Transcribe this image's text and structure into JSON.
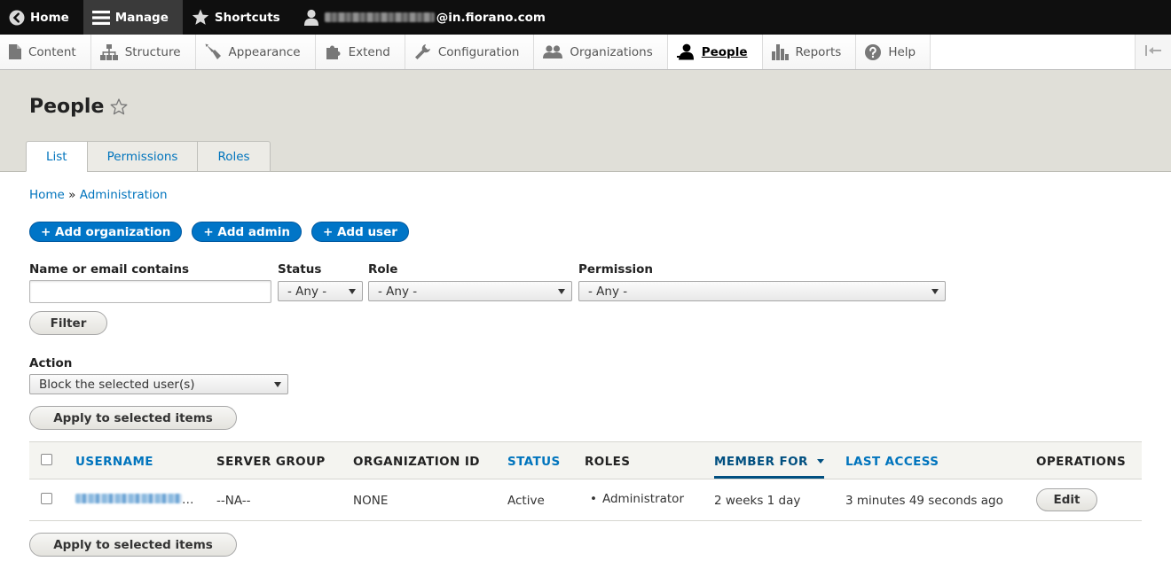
{
  "toolbar": {
    "home": "Home",
    "manage": "Manage",
    "shortcuts": "Shortcuts",
    "user_email_suffix": "@in.fiorano.com"
  },
  "tray": {
    "items": [
      {
        "label": "Content",
        "icon": "file-icon"
      },
      {
        "label": "Structure",
        "icon": "sitemap-icon"
      },
      {
        "label": "Appearance",
        "icon": "brush-icon"
      },
      {
        "label": "Extend",
        "icon": "puzzle-icon"
      },
      {
        "label": "Configuration",
        "icon": "wrench-icon"
      },
      {
        "label": "Organizations",
        "icon": "group-icon"
      },
      {
        "label": "People",
        "icon": "person-icon"
      },
      {
        "label": "Reports",
        "icon": "bar-chart-icon"
      },
      {
        "label": "Help",
        "icon": "help-icon"
      }
    ],
    "active": "People"
  },
  "page": {
    "title": "People",
    "tabs": [
      "List",
      "Permissions",
      "Roles"
    ],
    "active_tab": "List"
  },
  "breadcrumb": {
    "home": "Home",
    "separator": "»",
    "administration": "Administration"
  },
  "actions": {
    "add_organization": "+ Add organization",
    "add_admin": "+ Add admin",
    "add_user": "+ Add user"
  },
  "filters": {
    "name_label": "Name or email contains",
    "name_value": "",
    "status_label": "Status",
    "status_value": "- Any -",
    "role_label": "Role",
    "role_value": "- Any -",
    "permission_label": "Permission",
    "permission_value": "- Any -",
    "filter_button": "Filter"
  },
  "bulk": {
    "action_label": "Action",
    "action_value": "Block the selected user(s)",
    "apply_button": "Apply to selected items"
  },
  "table": {
    "headers": {
      "username": "USERNAME",
      "server_group": "SERVER GROUP",
      "organization_id": "ORGANIZATION ID",
      "status": "STATUS",
      "roles": "ROLES",
      "member_for": "MEMBER FOR",
      "last_access": "LAST ACCESS",
      "operations": "OPERATIONS"
    },
    "rows": [
      {
        "username_suffix": "…",
        "server_group": "--NA--",
        "organization_id": "NONE",
        "status": "Active",
        "role": "Administrator",
        "member_for": "2 weeks 1 day",
        "last_access": "3 minutes 49 seconds ago",
        "edit": "Edit"
      }
    ]
  },
  "colors": {
    "link": "#0074bd",
    "primary_button": "#0075c7",
    "toolbar": "#0f0f0f",
    "header_region": "#e0dfd8"
  }
}
